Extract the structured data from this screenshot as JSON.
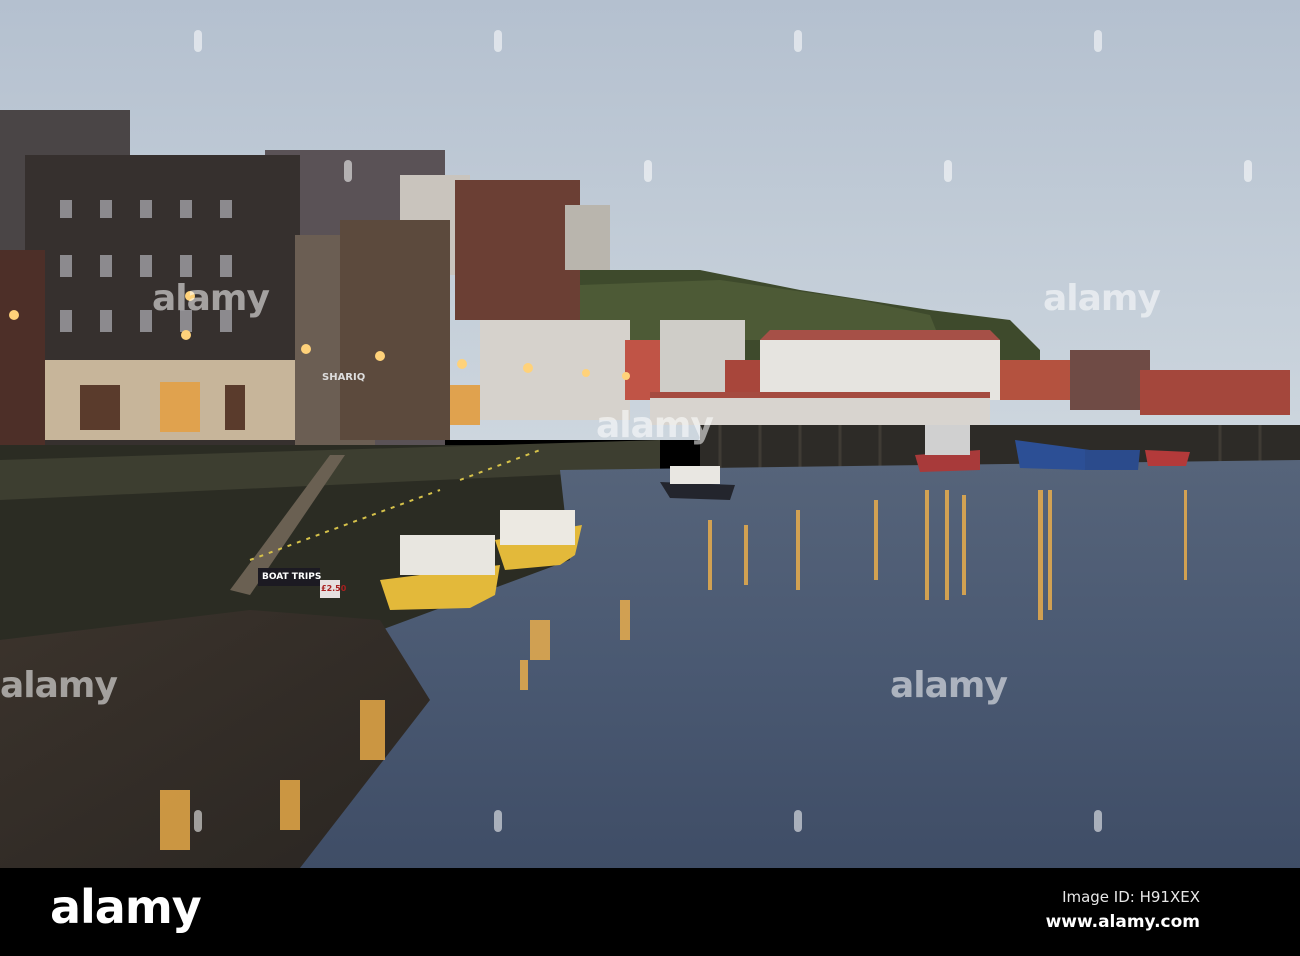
{
  "photo": {
    "subject": "harbour-at-dusk",
    "signs": {
      "boat_trips": "BOAT TRIPS",
      "price": "£2.50",
      "shop": "SHARIQ"
    },
    "colors": {
      "sky": "#bcc7d4",
      "water": "#4b5b74",
      "lights": "#f2b24a"
    }
  },
  "watermark": {
    "text": "alamy"
  },
  "footer": {
    "logo": "alamy",
    "image_id": "Image ID: H91XEX",
    "website": "www.alamy.com"
  }
}
